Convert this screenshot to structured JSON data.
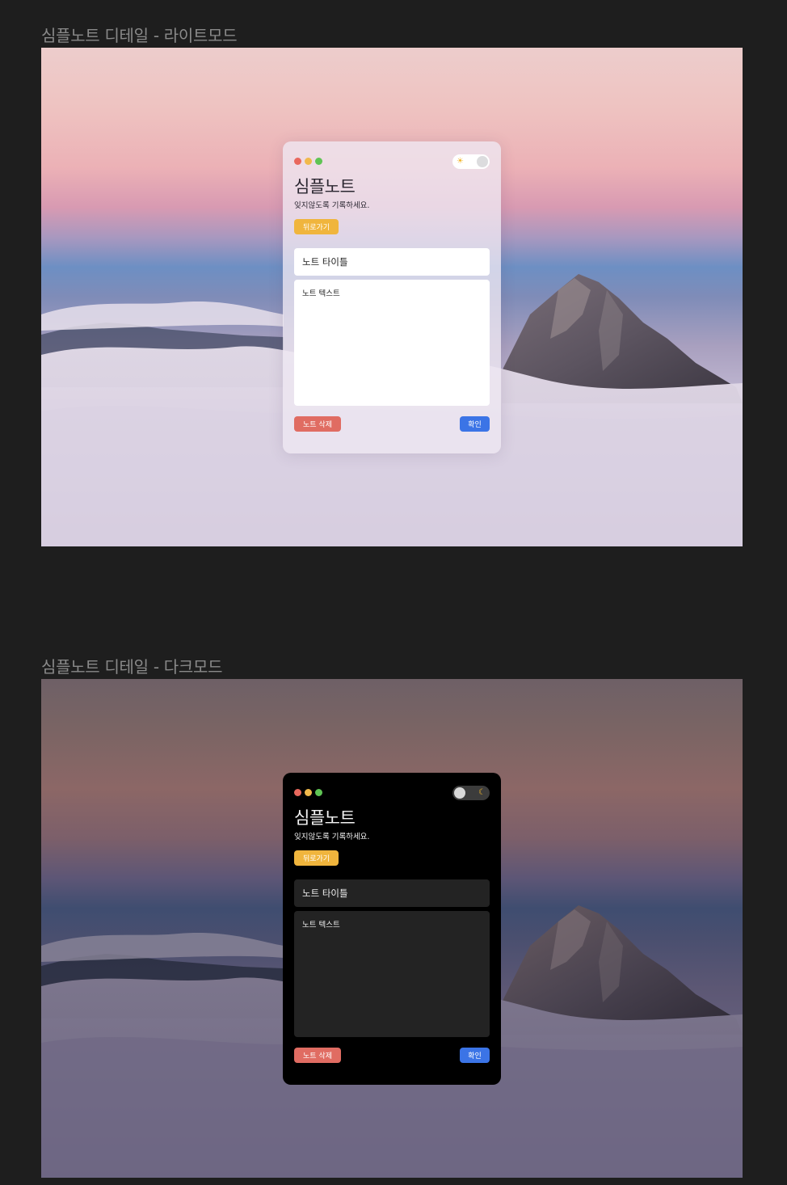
{
  "light_frame": {
    "label": "심플노트 디테일 - 라이트모드",
    "app": {
      "title": "심플노트",
      "subtitle": "잊지않도록 기록하세요.",
      "back_label": "뒤로가기",
      "note_title": "노트 타이틀",
      "note_text": "노트 텍스트",
      "delete_label": "노트 삭제",
      "confirm_label": "확인",
      "theme_toggle": {
        "mode": "light",
        "icon": "sun-icon"
      }
    }
  },
  "dark_frame": {
    "label": "심플노트 디테일 - 다크모드",
    "app": {
      "title": "심플노트",
      "subtitle": "잊지않도록 기록하세요.",
      "back_label": "뒤로가기",
      "note_title": "노트 타이틀",
      "note_text": "노트 텍스트",
      "delete_label": "노트 삭제",
      "confirm_label": "확인",
      "theme_toggle": {
        "mode": "dark",
        "icon": "moon-icon"
      }
    }
  },
  "colors": {
    "accent_back": "#f0b53d",
    "delete": "#e06c62",
    "confirm": "#3b74e6",
    "window_close": "#e9685d",
    "window_minimize": "#f1b94b",
    "window_maximize": "#5fc454"
  }
}
